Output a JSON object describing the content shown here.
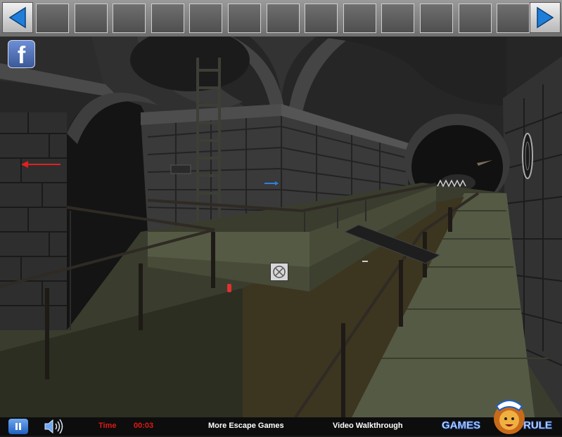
{
  "top_bar": {
    "inventory_slot_count": 13
  },
  "social": {
    "icon_letter": "f"
  },
  "bottom_bar": {
    "time_label": "Time",
    "time_value": "00:03",
    "more_games": "More Escape Games",
    "walkthrough": "Video Walkthrough",
    "logo_left": "GAMES",
    "logo_right": "RULE"
  },
  "colors": {
    "nav_arrow": "#1f7fd8",
    "time_text": "#e01818",
    "hint_arrow_left": "#e02020",
    "hint_arrow_center": "#2f7fe0",
    "facebook": "#3b5998"
  }
}
